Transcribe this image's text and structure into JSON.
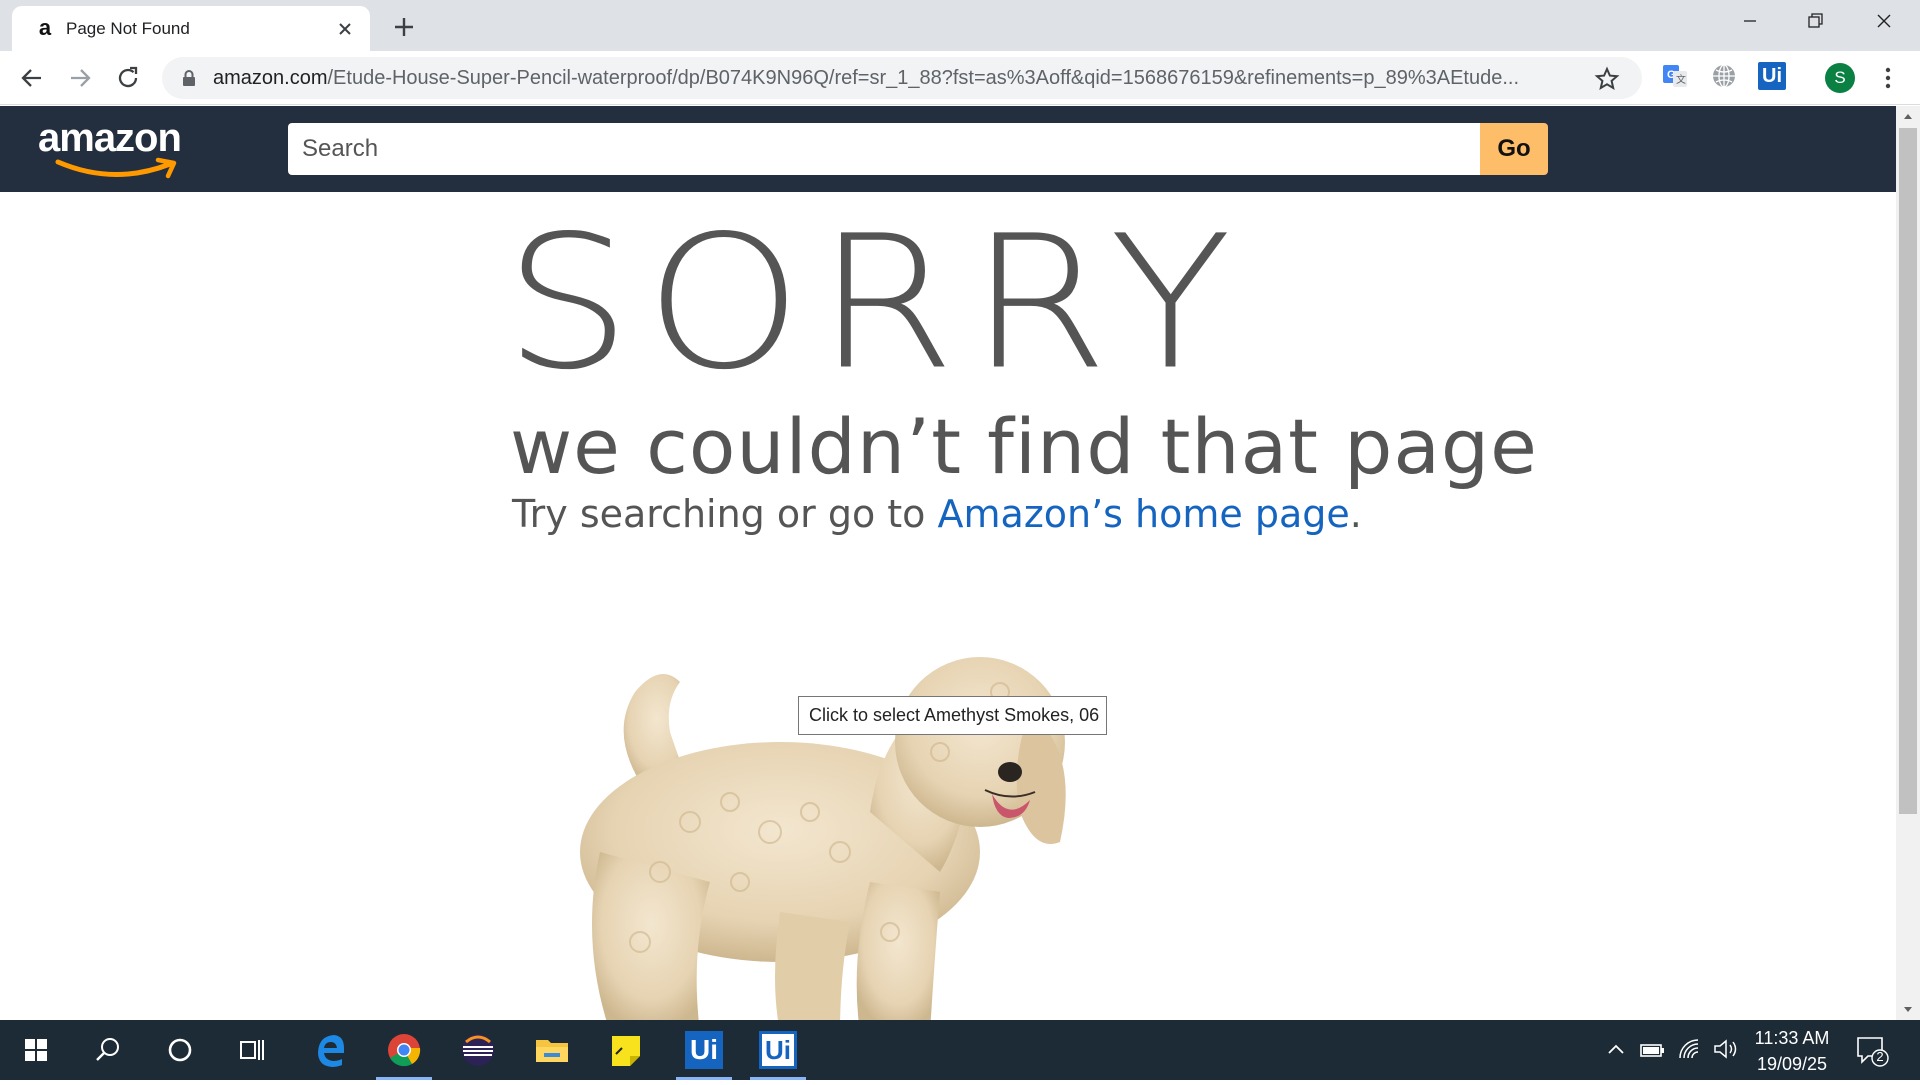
{
  "browser": {
    "tab_title": "Page Not Found",
    "tab_favicon": "a",
    "url_host": "amazon.com",
    "url_path": "/Etude-House-Super-Pencil-waterproof/dp/B074K9N96Q/ref=sr_1_88?fst=as%3Aoff&qid=1568676159&refinements=p_89%3AEtude...",
    "profile_initial": "S",
    "extension_ui_label": "Ui"
  },
  "amazon": {
    "logo_text": "amazon",
    "search_placeholder": "Search",
    "go_label": "Go"
  },
  "error_page": {
    "headline": "SORRY",
    "subheadline": "we couldn’t find that page",
    "try_text": "Try searching or go to ",
    "home_link": "Amazon’s home page",
    "period": "."
  },
  "tooltip": {
    "text": "Click to select Amethyst Smokes, 06"
  },
  "taskbar": {
    "ui_label_1": "Ui",
    "ui_label_2": "Ui",
    "time": "11:33 AM",
    "date": "19/09/25",
    "notification_count": "2"
  }
}
